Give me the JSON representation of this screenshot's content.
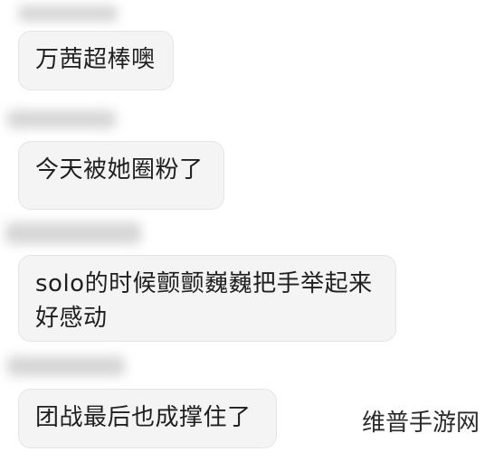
{
  "messages": [
    {
      "text": "万茜超棒噢"
    },
    {
      "text": "今天被她圈粉了"
    },
    {
      "text": "solo的时候颤颤巍巍把手举起来好感动"
    },
    {
      "text": "团战最后也成撑住了"
    }
  ],
  "watermark": "维普手游网"
}
